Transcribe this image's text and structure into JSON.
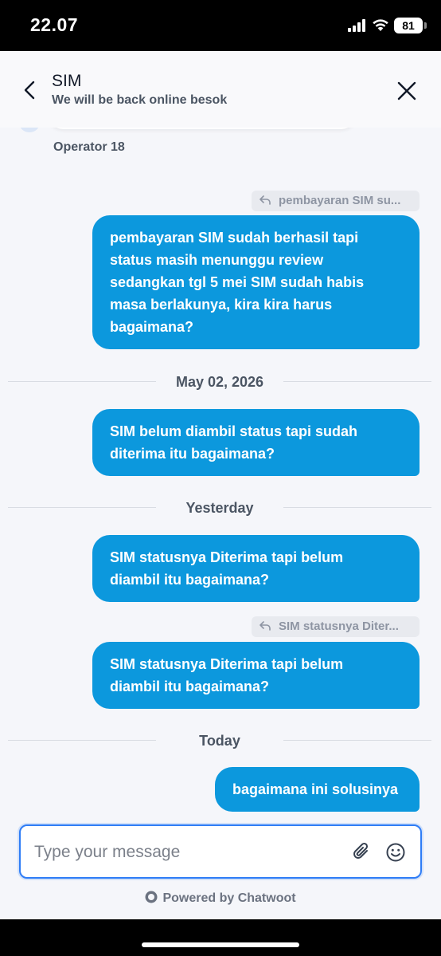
{
  "status_bar": {
    "time": "22.07",
    "battery": "81"
  },
  "header": {
    "title": "SIM",
    "subtitle": "We will be back online besok"
  },
  "conversation": {
    "operator_name": "Operator 18",
    "messages": [
      {
        "reply_to": "pembayaran SIM su...",
        "lines": [
          "pembayaran SIM sudah berhasil tapi",
          "status masih menunggu review",
          "sedangkan tgl 5 mei SIM sudah habis",
          "masa berlakunya, kira kira harus",
          "bagaimana?"
        ]
      },
      {
        "divider": "May 02, 2026"
      },
      {
        "lines": [
          "SIM belum diambil status tapi sudah",
          "diterima itu bagaimana?"
        ]
      },
      {
        "divider": "Yesterday"
      },
      {
        "lines": [
          "SIM statusnya Diterima tapi belum",
          "diambil itu bagaimana?"
        ]
      },
      {
        "reply_to": "SIM statusnya Diter...",
        "lines": [
          "SIM statusnya Diterima tapi belum",
          "diambil itu bagaimana?"
        ]
      },
      {
        "divider": "Today"
      },
      {
        "lines": [
          "bagaimana ini solusinya"
        ]
      }
    ]
  },
  "composer": {
    "placeholder": "Type your message"
  },
  "footer": {
    "powered_by": "Powered by Chatwoot"
  },
  "colors": {
    "bubble": "#0c98dd",
    "composer_border": "#2f7df6",
    "background": "#f5f6fa"
  },
  "icons": [
    "back-chevron-icon",
    "close-icon",
    "reply-icon",
    "attach-paperclip-icon",
    "emoji-smile-icon",
    "chatwoot-logo-icon"
  ]
}
